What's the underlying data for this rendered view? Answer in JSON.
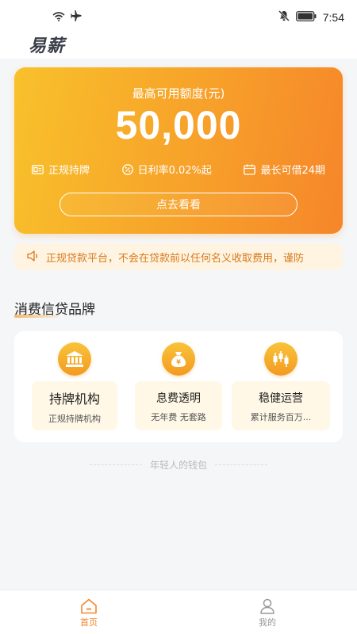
{
  "status_bar": {
    "time": "7:54",
    "icons": [
      "wifi-icon",
      "airplane-icon",
      "mute-icon",
      "battery-icon"
    ]
  },
  "app": {
    "logo_text": "易薪"
  },
  "hero": {
    "label": "最高可用额度(元)",
    "amount": "50,000",
    "features": [
      {
        "icon": "license-icon",
        "text": "正规持牌"
      },
      {
        "icon": "percent-icon",
        "text": "日利率0.02%起"
      },
      {
        "icon": "calendar-icon",
        "text": "最长可借24期"
      }
    ],
    "button_label": "点去看看"
  },
  "notice": {
    "icon": "speaker-icon",
    "text": "正规贷款平台，不会在贷款前以任何名义收取费用，谨防"
  },
  "brand_section": {
    "title": "消费信贷品牌",
    "items": [
      {
        "icon": "bank-icon",
        "title": "持牌机构",
        "subtitle": "正规持牌机构"
      },
      {
        "icon": "money-bag-icon",
        "title": "息费透明",
        "subtitle": "无年费 无套路"
      },
      {
        "icon": "candlestick-icon",
        "title": "稳健运营",
        "subtitle": "累计服务百万..."
      }
    ]
  },
  "tagline": "年轻人的钱包",
  "tabs": [
    {
      "label": "首页",
      "icon": "home-icon",
      "active": true
    },
    {
      "label": "我的",
      "icon": "user-icon",
      "active": false
    }
  ],
  "colors": {
    "accent": "#f3862a",
    "card_gradient_start": "#f8c12b",
    "card_gradient_end": "#f6862a",
    "notice_text": "#d67a1c"
  }
}
